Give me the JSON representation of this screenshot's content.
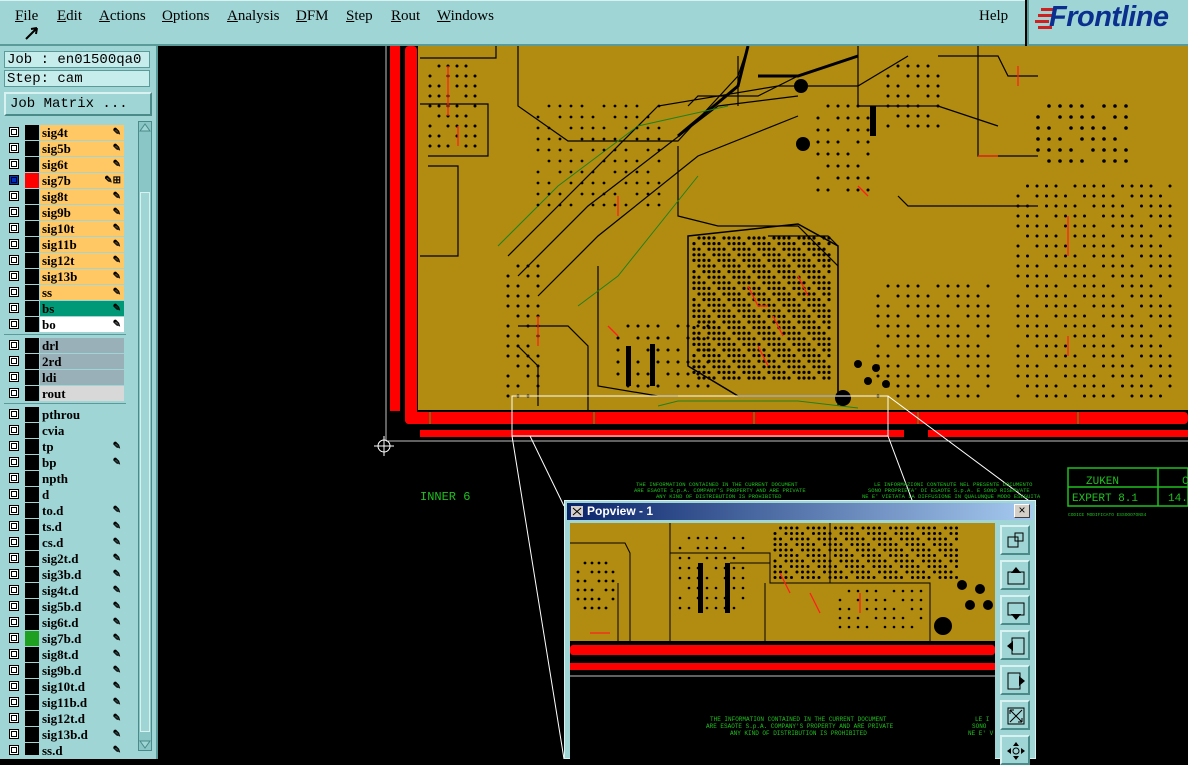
{
  "menubar": {
    "items": [
      "File",
      "Edit",
      "Actions",
      "Options",
      "Analysis",
      "DFM",
      "Step",
      "Rout",
      "Windows"
    ],
    "help": "Help"
  },
  "logo": {
    "text": "Frontline"
  },
  "panel": {
    "job": "Job : en01500qa0",
    "step": "Step: cam",
    "job_matrix": "Job Matrix ..."
  },
  "layers": [
    {
      "name": "sig4t",
      "color": "#ffc864",
      "mark": "✎"
    },
    {
      "name": "sig5b",
      "color": "#ffc864",
      "mark": "✎"
    },
    {
      "name": "sig6t",
      "color": "#ffc864",
      "mark": "✎"
    },
    {
      "name": "sig7b",
      "color": "#ffc864",
      "mark": "✎⊞"
    },
    {
      "name": "sig8t",
      "color": "#ffc864",
      "mark": "✎"
    },
    {
      "name": "sig9b",
      "color": "#ffc864",
      "mark": "✎"
    },
    {
      "name": "sig10t",
      "color": "#ffc864",
      "mark": "✎"
    },
    {
      "name": "sig11b",
      "color": "#ffc864",
      "mark": "✎"
    },
    {
      "name": "sig12t",
      "color": "#ffc864",
      "mark": "✎"
    },
    {
      "name": "sig13b",
      "color": "#ffc864",
      "mark": "✎"
    },
    {
      "name": "ss",
      "color": "#ffc864",
      "mark": "✎"
    },
    {
      "name": "bs",
      "color": "#009977",
      "mark": "✎"
    },
    {
      "name": "bo",
      "color": "#ffffff",
      "mark": "✎"
    },
    {
      "sep": true
    },
    {
      "name": "drl",
      "color": "#99b0b8",
      "mark": ""
    },
    {
      "name": "2rd",
      "color": "#99b0b8",
      "mark": ""
    },
    {
      "name": "ldi",
      "color": "#99b0b8",
      "mark": ""
    },
    {
      "name": "rout",
      "color": "#d8d8d8",
      "mark": ""
    },
    {
      "sep": true
    },
    {
      "name": "pthrou",
      "color": "#9fd5d4",
      "mark": ""
    },
    {
      "name": "cvia",
      "color": "#9fd5d4",
      "mark": ""
    },
    {
      "name": "tp",
      "color": "#9fd5d4",
      "mark": "✎"
    },
    {
      "name": "bp",
      "color": "#9fd5d4",
      "mark": "✎"
    },
    {
      "name": "npth",
      "color": "#9fd5d4",
      "mark": ""
    },
    {
      "name": "d",
      "color": "#9fd5d4",
      "mark": ""
    },
    {
      "name": "to.d",
      "color": "#9fd5d4",
      "mark": "✎"
    },
    {
      "name": "ts.d",
      "color": "#9fd5d4",
      "mark": "✎"
    },
    {
      "name": "cs.d",
      "color": "#9fd5d4",
      "mark": "✎"
    },
    {
      "name": "sig2t.d",
      "color": "#9fd5d4",
      "mark": "✎"
    },
    {
      "name": "sig3b.d",
      "color": "#9fd5d4",
      "mark": "✎"
    },
    {
      "name": "sig4t.d",
      "color": "#9fd5d4",
      "mark": "✎"
    },
    {
      "name": "sig5b.d",
      "color": "#9fd5d4",
      "mark": "✎"
    },
    {
      "name": "sig6t.d",
      "color": "#9fd5d4",
      "mark": "✎"
    },
    {
      "name": "sig7b.d",
      "color": "#9fd5d4",
      "mark": "✎"
    },
    {
      "name": "sig8t.d",
      "color": "#9fd5d4",
      "mark": "✎"
    },
    {
      "name": "sig9b.d",
      "color": "#9fd5d4",
      "mark": "✎"
    },
    {
      "name": "sig10t.d",
      "color": "#9fd5d4",
      "mark": "✎"
    },
    {
      "name": "sig11b.d",
      "color": "#9fd5d4",
      "mark": "✎"
    },
    {
      "name": "sig12t.d",
      "color": "#9fd5d4",
      "mark": "✎"
    },
    {
      "name": "sig13b.d",
      "color": "#9fd5d4",
      "mark": "✎"
    },
    {
      "name": "ss.d",
      "color": "#9fd5d4",
      "mark": "✎"
    }
  ],
  "canvas": {
    "layer_label": "INNER 6",
    "notice_1": "THE INFORMATION CONTAINED IN THE CURRENT DOCUMENT",
    "notice_2": "ARE ESAOTE S.p.A. COMPANY'S PROPERTY AND ARE PRIVATE",
    "notice_3": "ANY KIND OF DISTRIBUTION IS PROHIBITED",
    "notice_it_1": "LE INFORMAZIONI CONTENUTE NEL PRESENTE DOCUMENTO",
    "notice_it_2": "SONO PROPRIETA' DI ESAOTE S.p.A. E SONO RISERVATE",
    "notice_it_3": "NE E' VIETATA LA DIFFUSIONE IN QUALUNQUE MODO ESEGUITA",
    "tb_1": "ZUKEN",
    "tb_2": "EXPERT 8.1",
    "tb_3": "14.",
    "tb_4": "C",
    "tb_code": "CODICE MODIFICATO ESSOOO7ONS4",
    "pop_notice_it_1": "LE I",
    "pop_notice_it_2": "SONO",
    "pop_notice_it_3": "NE E' V"
  },
  "popview": {
    "title": "Popview - 1",
    "close": "×"
  },
  "colors": {
    "board": "#b28c10",
    "copper": "#ff0000",
    "ui": "#9fd5d4",
    "text_green": "#20c020"
  }
}
